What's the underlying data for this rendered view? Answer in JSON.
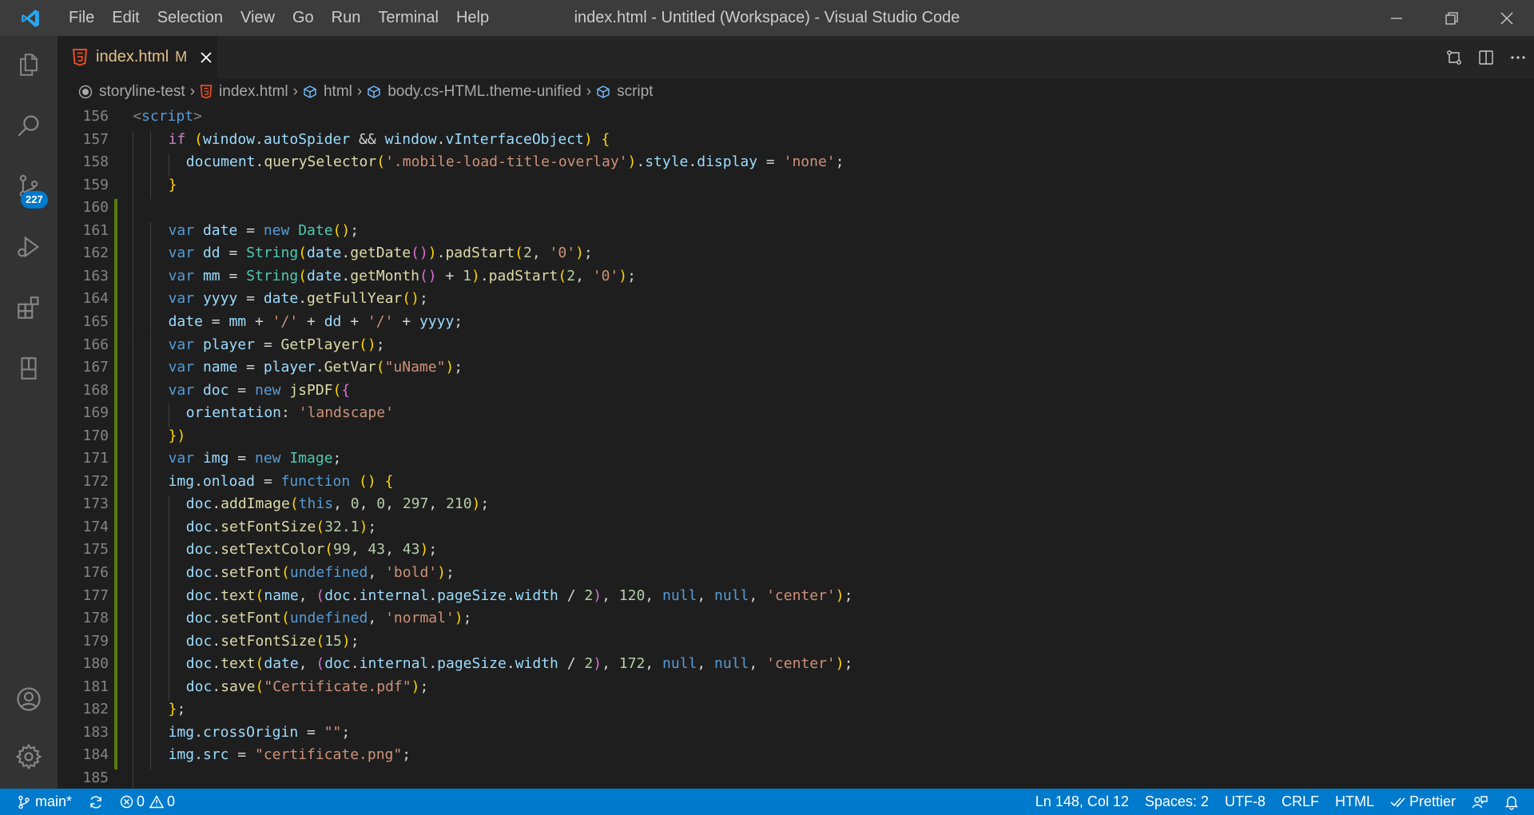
{
  "window": {
    "title": "index.html - Untitled (Workspace) - Visual Studio Code",
    "menu": [
      "File",
      "Edit",
      "Selection",
      "View",
      "Go",
      "Run",
      "Terminal",
      "Help"
    ]
  },
  "activity_bar": {
    "items": [
      "explorer-icon",
      "search-icon",
      "source-control-icon",
      "run-debug-icon",
      "extensions-icon",
      "remote-explorer-icon"
    ],
    "scm_badge": "227",
    "bottom": [
      "accounts-icon",
      "manage-gear-icon"
    ]
  },
  "tab": {
    "filename": "index.html",
    "status": "M"
  },
  "breadcrumbs": [
    "storyline-test",
    "index.html",
    "html",
    "body.cs-HTML.theme-unified",
    "script"
  ],
  "editor": {
    "line_numbers": [
      "156",
      "157",
      "158",
      "159",
      "160",
      "161",
      "162",
      "163",
      "164",
      "165",
      "166",
      "167",
      "168",
      "169",
      "170",
      "171",
      "172",
      "173",
      "174",
      "175",
      "176",
      "177",
      "178",
      "179",
      "180",
      "181",
      "182",
      "183",
      "184",
      "185"
    ],
    "lines": [
      "<script>",
      "if (window.autoSpider && window.vInterfaceObject) {",
      "document.querySelector('.mobile-load-title-overlay').style.display = 'none';",
      "}",
      "",
      "var date = new Date();",
      "var dd = String(date.getDate()).padStart(2, '0');",
      "var mm = String(date.getMonth() + 1).padStart(2, '0');",
      "var yyyy = date.getFullYear();",
      "date = mm + '/' + dd + '/' + yyyy;",
      "var player = GetPlayer();",
      "var name = player.GetVar(\"uName\");",
      "var doc = new jsPDF({",
      "orientation: 'landscape'",
      "})",
      "var img = new Image;",
      "img.onload = function () {",
      "doc.addImage(this, 0, 0, 297, 210);",
      "doc.setFontSize(32.1);",
      "doc.setTextColor(99, 43, 43);",
      "doc.setFont(undefined, 'bold');",
      "doc.text(name, (doc.internal.pageSize.width / 2), 120, null, null, 'center');",
      "doc.setFont(undefined, 'normal');",
      "doc.setFontSize(15);",
      "doc.text(date, (doc.internal.pageSize.width / 2), 172, null, null, 'center');",
      "doc.save(\"Certificate.pdf\");",
      "};",
      "img.crossOrigin = \"\";",
      "img.src = \"certificate.png\";",
      ""
    ]
  },
  "statusbar": {
    "branch": "main*",
    "errors": "0",
    "warnings": "0",
    "cursor": "Ln 148, Col 12",
    "spaces": "Spaces: 2",
    "encoding": "UTF-8",
    "eol": "CRLF",
    "language": "HTML",
    "formatter": "Prettier"
  },
  "colors": {
    "titlebar": "#3c3c3c",
    "activitybar": "#333333",
    "editor": "#1e1e1e",
    "statusbar": "#007acc",
    "modified": "#e2c08d"
  }
}
